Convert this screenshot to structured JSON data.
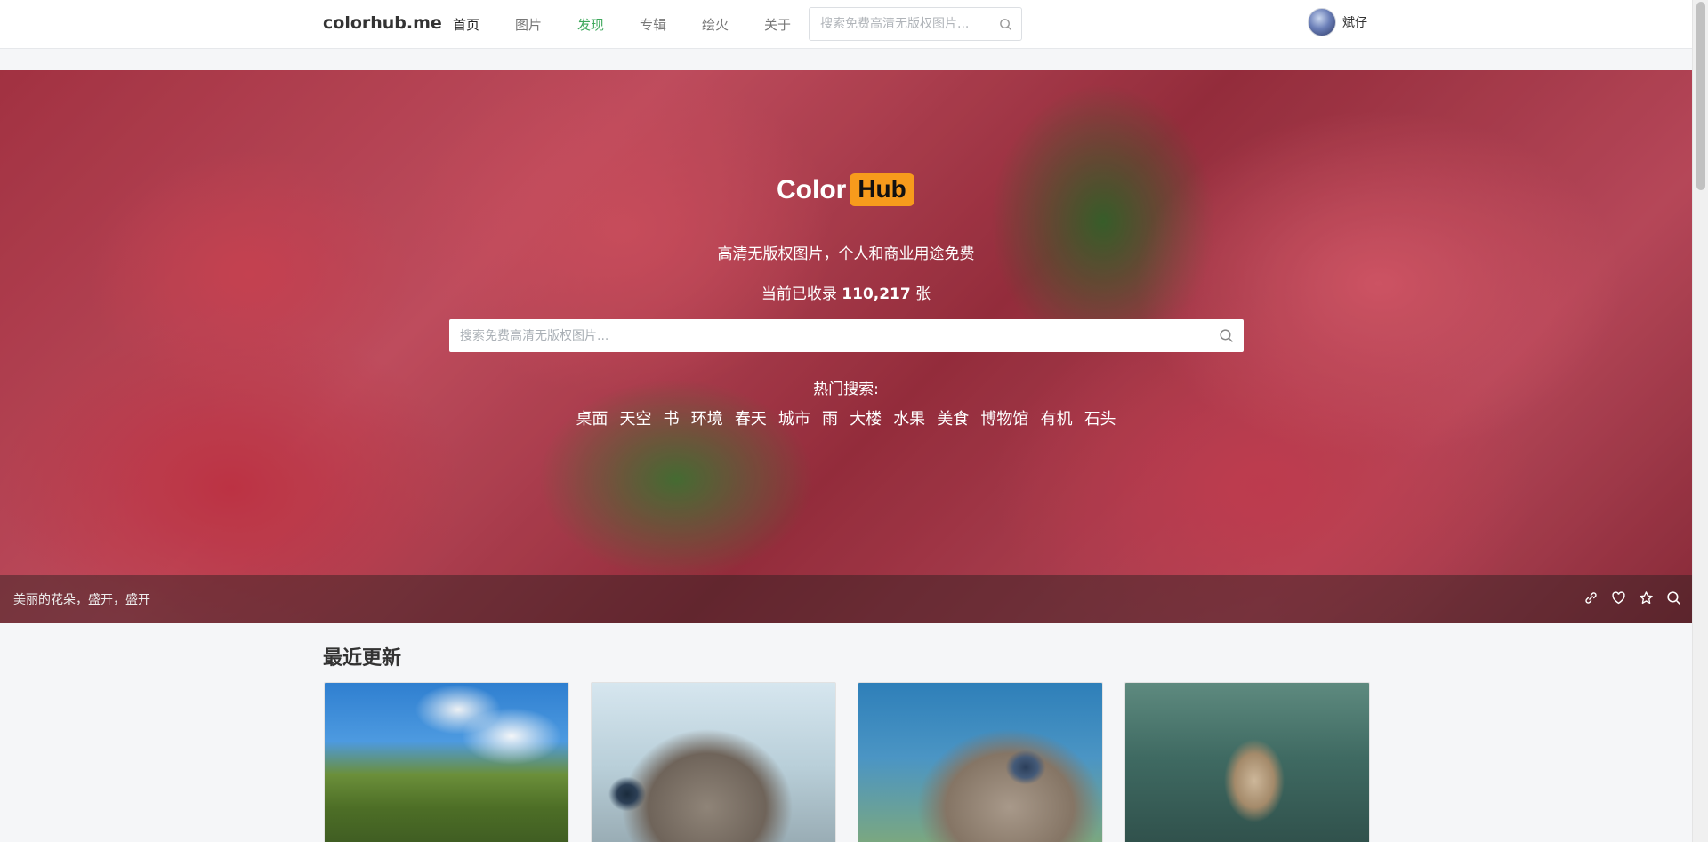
{
  "navbar": {
    "brand": "colorhub.me",
    "items": [
      {
        "label": "首页",
        "state": "active"
      },
      {
        "label": "图片",
        "state": "normal"
      },
      {
        "label": "发现",
        "state": "highlight"
      },
      {
        "label": "专辑",
        "state": "normal"
      },
      {
        "label": "绘火",
        "state": "normal"
      },
      {
        "label": "关于",
        "state": "normal"
      }
    ],
    "search_placeholder": "搜索免费高清无版权图片...",
    "username": "斌仔"
  },
  "hero": {
    "logo_left": "Color",
    "logo_right": "Hub",
    "tagline": "高清无版权图片，个人和商业用途免费",
    "count_prefix": "当前已收录 ",
    "count_value": "110,217",
    "count_suffix": " 张",
    "search_placeholder": "搜索免费高清无版权图片...",
    "hot_title": "热门搜索:",
    "hot_tags": [
      "桌面",
      "天空",
      "书",
      "环境",
      "春天",
      "城市",
      "雨",
      "大楼",
      "水果",
      "美食",
      "博物馆",
      "有机",
      "石头"
    ],
    "caption": "美丽的花朵，盛开，盛开",
    "actions": [
      "link-icon",
      "heart-icon",
      "star-icon",
      "search-icon"
    ]
  },
  "recent": {
    "title": "最近更新",
    "cards": [
      "trees-landscape",
      "ostrich-front",
      "ostrich-side",
      "monkey"
    ]
  },
  "colors": {
    "accent_green": "#3fa85c",
    "logo_orange": "#f79b1c"
  }
}
